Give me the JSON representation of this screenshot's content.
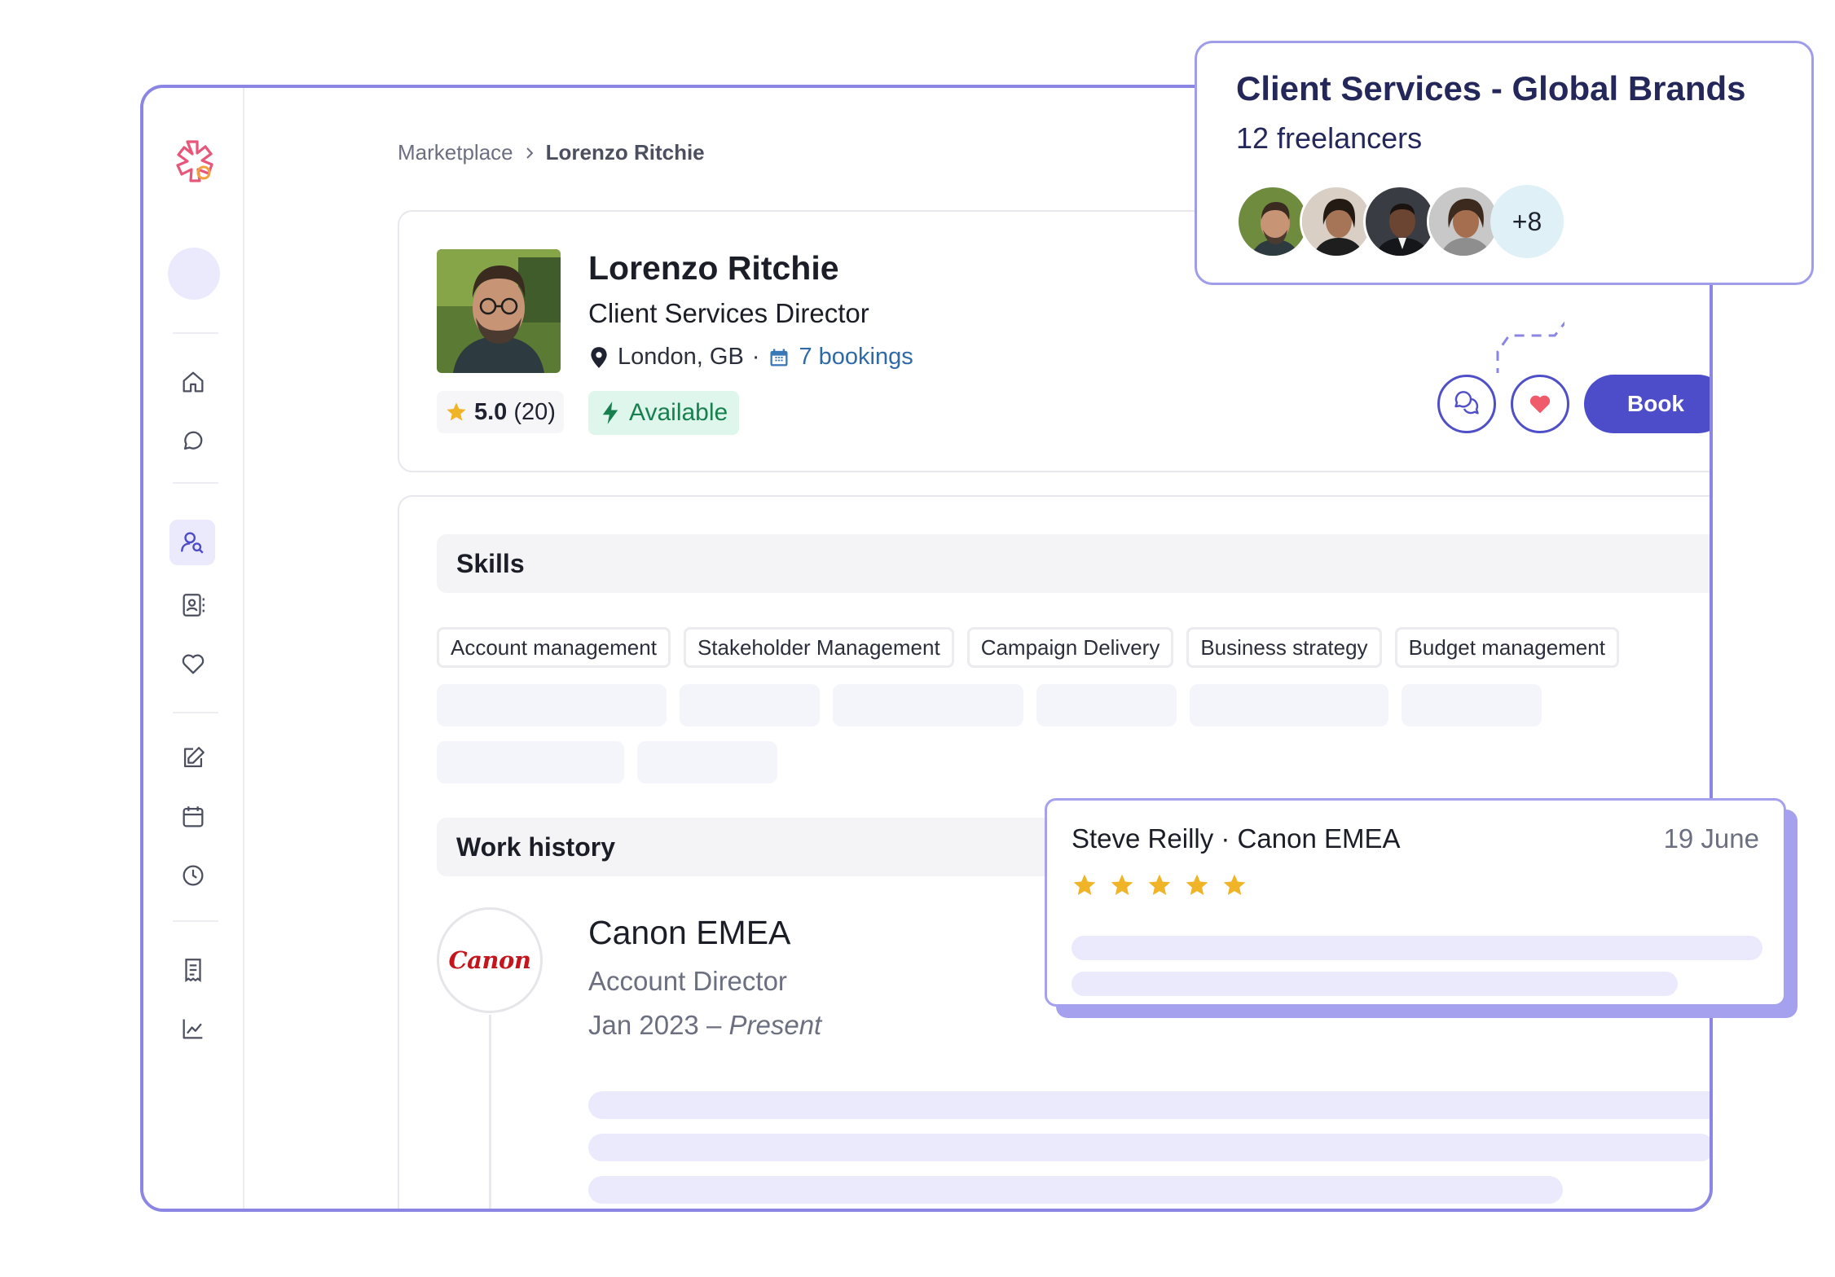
{
  "breadcrumb": {
    "root": "Marketplace",
    "current": "Lorenzo Ritchie"
  },
  "profile": {
    "name": "Lorenzo Ritchie",
    "title": "Client Services Director",
    "location": "London, GB",
    "separator": "·",
    "bookings": "7 bookings",
    "rating": "5.0",
    "rating_count": "(20)",
    "availability": "Available",
    "book_label": "Book"
  },
  "skills": {
    "heading": "Skills",
    "items": [
      "Account management",
      "Stakeholder Management",
      "Campaign Delivery",
      "Business strategy",
      "Budget management"
    ]
  },
  "work_history": {
    "heading": "Work history",
    "jobs": [
      {
        "company": "Canon EMEA",
        "logo_text": "Canon",
        "role": "Account Director",
        "start": "Jan 2023 – ",
        "end": "Present"
      }
    ]
  },
  "team": {
    "title": "Client Services - Global Brands",
    "count": "12 freelancers",
    "more": "+8"
  },
  "review": {
    "author": "Steve Reilly · Canon EMEA",
    "date": "19 June",
    "stars": 5
  },
  "colors": {
    "accent": "#4d4cc9",
    "window_border": "#8b86e3",
    "available_bg": "#def6ec",
    "available_text": "#18804f",
    "star": "#f0b429",
    "heart": "#ef5b6b",
    "brand_logo": "#e8567a"
  },
  "icons": {
    "sidebar": [
      "home-icon",
      "chat-icon",
      "user-search-icon",
      "contacts-icon",
      "heart-icon",
      "edit-icon",
      "calendar-icon",
      "clock-icon",
      "receipt-icon",
      "chart-icon"
    ]
  }
}
